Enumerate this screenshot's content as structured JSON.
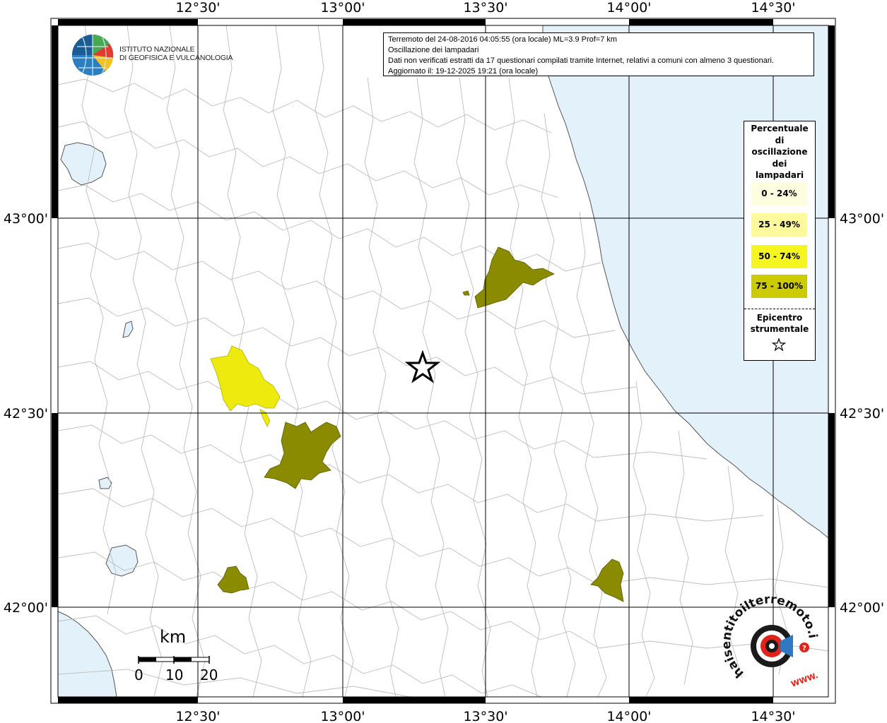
{
  "map": {
    "top_ticks": [
      "12°30'",
      "13°00'",
      "13°30'",
      "14°00'",
      "14°30'"
    ],
    "bottom_ticks": [
      "12°30'",
      "13°00'",
      "13°30'",
      "14°00'",
      "14°30'"
    ],
    "left_ticks": [
      "43°00'",
      "42°30'",
      "42°00'"
    ],
    "right_ticks": [
      "43°00'",
      "42°30'",
      "42°00'"
    ],
    "colors": {
      "sea": "#e3f1fb",
      "land": "#ffffff",
      "boundary": "#bdbdbd",
      "grid": "#000000",
      "class_0_24": "#fdfde0",
      "class_25_49": "#fcfa9c",
      "class_50_74": "#eeea0d",
      "class_75_100": "#8b8b00"
    }
  },
  "info": {
    "line1": "Terremoto del 24-08-2016 04:05:55 (ora locale) ML=3.9 Prof=7 km",
    "line2": "Oscillazione dei lampadari",
    "line3": "Dati non verificati estratti da 17 questionari compilati tramite Internet, relativi a comuni con almeno 3 questionari.",
    "line4": "Aggiornato il: 19-12-2025 19:21 (ora locale)"
  },
  "legend": {
    "title_lines": [
      "Percentuale",
      "di",
      "oscillazione",
      "dei",
      "lampadari"
    ],
    "classes": [
      {
        "label": "0 - 24%",
        "color": "#fdfde0"
      },
      {
        "label": "25 - 49%",
        "color": "#fcfa9c"
      },
      {
        "label": "50 - 74%",
        "color": "#f5f51f"
      },
      {
        "label": "75 - 100%",
        "color": "#cbcb00"
      }
    ],
    "epicenter_lines": [
      "Epicentro",
      "strumentale"
    ],
    "epicenter_icon": "star-icon"
  },
  "logo": {
    "line1": "ISTITUTO NAZIONALE",
    "line2": "DI GEOFISICA E VULCANOLOGIA"
  },
  "scale": {
    "unit": "km",
    "labels": [
      "0",
      "10",
      "20"
    ]
  },
  "hsit_logo": {
    "text": "haisentitoilterremoto.it",
    "www": "WWW."
  }
}
